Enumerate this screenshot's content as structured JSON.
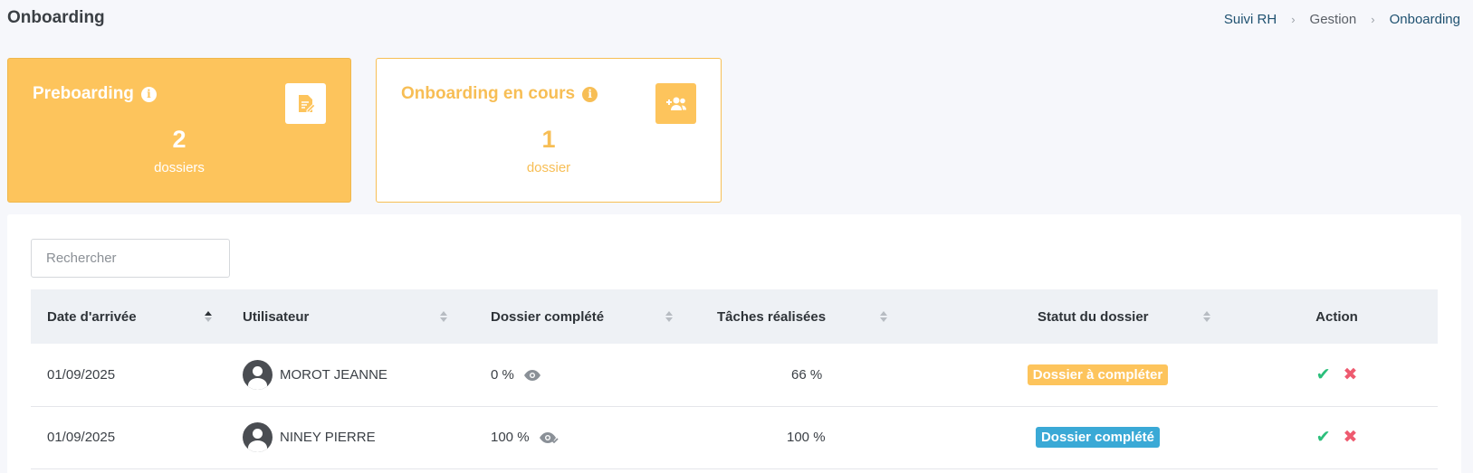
{
  "page": {
    "title": "Onboarding"
  },
  "breadcrumb": [
    "Suivi RH",
    "Gestion",
    "Onboarding"
  ],
  "cards": [
    {
      "title": "Preboarding",
      "count": "2",
      "unit": "dossiers",
      "icon": "file-edit-icon"
    },
    {
      "title": "Onboarding en cours",
      "count": "1",
      "unit": "dossier",
      "icon": "users-plus-icon"
    }
  ],
  "search": {
    "placeholder": "Rechercher",
    "value": ""
  },
  "table": {
    "columns": [
      "Date d'arrivée",
      "Utilisateur",
      "Dossier complété",
      "Tâches réalisées",
      "Statut du dossier",
      "Action"
    ],
    "rows": [
      {
        "date": "01/09/2025",
        "user": "MOROT JEANNE",
        "dossier": "0 %",
        "taches": "66 %",
        "statut": "Dossier à compléter",
        "statut_kind": "warning"
      },
      {
        "date": "01/09/2025",
        "user": "NINEY PIERRE",
        "dossier": "100 %",
        "taches": "100 %",
        "statut": "Dossier complété",
        "statut_kind": "info"
      }
    ]
  },
  "colors": {
    "accent": "#fdc45c",
    "info": "#3aa9d6",
    "success": "#2bbf7b",
    "danger": "#ee5a6f"
  }
}
